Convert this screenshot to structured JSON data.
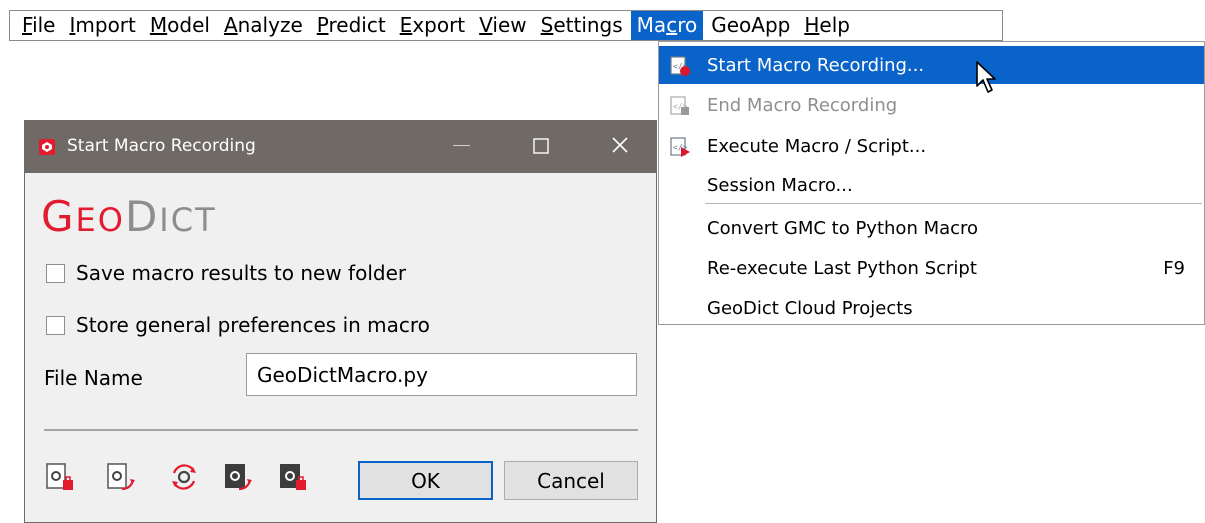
{
  "menubar": {
    "items": [
      {
        "label": "File",
        "mnemonic": "F",
        "rest": "ile",
        "active": false
      },
      {
        "label": "Import",
        "mnemonic": "I",
        "rest": "mport",
        "active": false
      },
      {
        "label": "Model",
        "mnemonic": "M",
        "rest": "odel",
        "active": false
      },
      {
        "label": "Analyze",
        "mnemonic": "A",
        "rest": "nalyze",
        "active": false
      },
      {
        "label": "Predict",
        "mnemonic": "P",
        "rest": "redict",
        "active": false
      },
      {
        "label": "Export",
        "mnemonic": "E",
        "rest": "xport",
        "active": false
      },
      {
        "label": "View",
        "mnemonic": "V",
        "rest": "iew",
        "active": false
      },
      {
        "label": "Settings",
        "mnemonic": "S",
        "rest": "ettings",
        "active": false
      },
      {
        "label": "Macro",
        "pre": "Ma",
        "mnemonic": "c",
        "rest": "ro",
        "active": true
      },
      {
        "label": "GeoApp",
        "mnemonic": "",
        "rest": "GeoApp",
        "active": false
      },
      {
        "label": "Help",
        "mnemonic": "H",
        "rest": "elp",
        "active": false
      }
    ]
  },
  "macro_menu": {
    "items": [
      {
        "label": "Start Macro Recording...",
        "icon": "start-recording-icon",
        "state": "selected"
      },
      {
        "label": "End Macro Recording",
        "icon": "end-recording-icon",
        "state": "disabled"
      },
      {
        "label": "Execute Macro / Script...",
        "icon": "execute-script-icon",
        "state": "normal"
      },
      {
        "label": "Session Macro...",
        "icon": "",
        "state": "normal"
      },
      {
        "label": "Convert GMC to Python Macro",
        "icon": "",
        "state": "normal"
      },
      {
        "label": "Re-execute Last Python Script",
        "icon": "",
        "state": "normal",
        "shortcut": "F9"
      },
      {
        "label": "GeoDict Cloud Projects",
        "icon": "",
        "state": "normal"
      }
    ]
  },
  "dialog": {
    "title": "Start Macro Recording",
    "logo": {
      "geo_first": "G",
      "geo_rest": "EO",
      "dict_first": "D",
      "dict_rest": "ICT"
    },
    "save_results_label": "Save macro results to new folder",
    "store_prefs_label": "Store general preferences in macro",
    "file_name_label": "File Name",
    "file_name_value": "GeoDictMacro.py",
    "ok_label": "OK",
    "cancel_label": "Cancel"
  },
  "colors": {
    "accent": "#0a63c9",
    "brand_red": "#e31b2f",
    "titlebar": "#6f6a66"
  }
}
